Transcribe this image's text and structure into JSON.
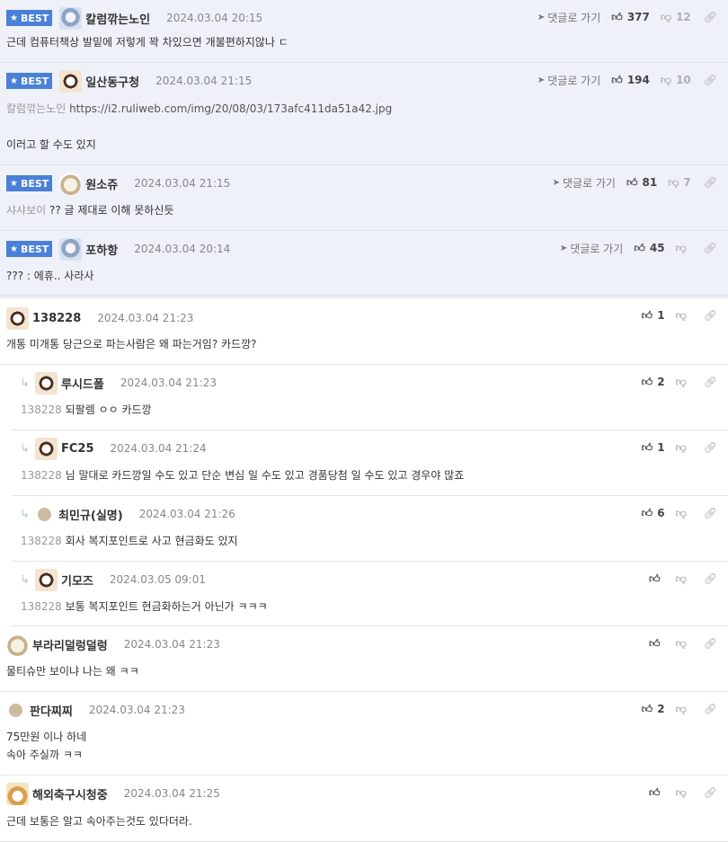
{
  "best_badge": "BEST",
  "goto_label": "댓글로 가기",
  "best_comments": [
    {
      "nick": "칼럼깎는노인",
      "time": "2024.03.04 20:15",
      "likes": "377",
      "dislikes": "12",
      "lines": [
        "근데 컴퓨터책상 발밑에 저렇게 꽉 차있으면 개불편하지않나 ㄷ"
      ]
    },
    {
      "nick": "일산동구청",
      "time": "2024.03.04 21:15",
      "likes": "194",
      "dislikes": "10",
      "target": "칼럼깎는노인",
      "link": "https://i2.ruliweb.com/img/20/08/03/173afc411da51a42.jpg",
      "lines": [
        "이러고 할 수도 있지"
      ]
    },
    {
      "nick": "원소쥬",
      "time": "2024.03.04 21:15",
      "likes": "81",
      "dislikes": "7",
      "target": "샤샤보이",
      "lines": [
        "?? 글 제대로 이해 못하신듯"
      ]
    },
    {
      "nick": "포하항",
      "time": "2024.03.04 20:14",
      "likes": "45",
      "dislikes": "",
      "lines": [
        "??? : 에휴.. 사라사"
      ]
    }
  ],
  "comments": [
    {
      "nick": "138228",
      "time": "2024.03.04 21:23",
      "likes": "1",
      "lines": [
        "개통 미개통 당근으로 파는사람은 왜 파는거임? 카드깡?"
      ]
    },
    {
      "nick": "루시드폴",
      "time": "2024.03.04 21:23",
      "likes": "2",
      "target": "138228",
      "lines": [
        "되팔렘 ㅇㅇ 카드깡"
      ]
    },
    {
      "nick": "FC25",
      "time": "2024.03.04 21:24",
      "likes": "1",
      "target": "138228",
      "lines": [
        "님 말대로 카드깡일 수도 있고 단순 변심 일 수도 있고 경품당첨 일 수도 있고 경우야 많죠"
      ]
    },
    {
      "nick": "최민규(실명)",
      "time": "2024.03.04 21:26",
      "likes": "6",
      "target": "138228",
      "lines": [
        "회사 복지포인트로 사고 현금화도 있지"
      ]
    },
    {
      "nick": "기모즈",
      "time": "2024.03.05 09:01",
      "likes": "",
      "target": "138228",
      "lines": [
        "보통 복지포인트 현금화하는거 아닌가 ㅋㅋㅋ"
      ]
    },
    {
      "nick": "부라리덜렁덜렁",
      "time": "2024.03.04 21:23",
      "likes": "",
      "lines": [
        "물티슈만 보이냐 나는 왜 ㅋㅋ"
      ]
    },
    {
      "nick": "판다찌찌",
      "time": "2024.03.04 21:23",
      "likes": "2",
      "lines": [
        "75만원 이나 하네",
        "속아 주실까 ㅋㅋ"
      ]
    },
    {
      "nick": "해외축구시청중",
      "time": "2024.03.04 21:25",
      "likes": "",
      "lines": [
        "근데 보통은 알고 속아주는것도 있다더라."
      ]
    }
  ],
  "icons": {
    "like": "thumbs-up-icon",
    "dislike": "thumbs-down-icon",
    "link": "link-icon",
    "goto": "arrow-icon",
    "reply": "reply-arrow-icon"
  },
  "colors": {
    "best_badge": "#4a80d6",
    "best_bg": "#eef1f8"
  }
}
